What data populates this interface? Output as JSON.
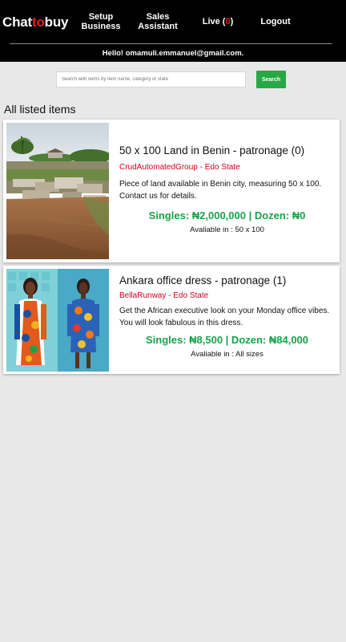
{
  "header": {
    "logo": {
      "part1": "Chat",
      "part2": "to",
      "part3": "buy"
    },
    "nav": {
      "setup_line1": "Setup",
      "setup_line2": "Business",
      "sales_line1": "Sales",
      "sales_line2": "Assistant",
      "live_label": "Live (",
      "live_count": "0",
      "live_close": ")",
      "logout": "Logout"
    },
    "greeting": "Hello! omamuli.emmanuel@gmail.com."
  },
  "search": {
    "placeholder": "Search with items by item name, category or state",
    "value": "",
    "button_label": "Search"
  },
  "section_title": "All listed items",
  "items": [
    {
      "title": "50 x 100 Land in Benin - patronage (0)",
      "seller": "CrudAutomatedGroup - Edo State",
      "description": "Piece of land available in Benin city, measuring 50 x 100. Contact us for details.",
      "price": "Singles: ₦2,000,000 | Dozen: ₦0",
      "availability": "Avaliable in : 50 x 100"
    },
    {
      "title": "Ankara office dress - patronage (1)",
      "seller": "BellaRunway - Edo State",
      "description": "Get the African executive look on your Monday office vibes. You will look fabulous in this dress.",
      "price": "Singles: ₦8,500 | Dozen: ₦84,000",
      "availability": "Avaliable in : All sizes"
    }
  ],
  "colors": {
    "brand_red": "#e02020",
    "accent_green": "#28a745",
    "price_green": "#16a34a",
    "seller_red": "#d0021b",
    "header_bg": "#000000",
    "page_bg": "#e8e8e8"
  }
}
